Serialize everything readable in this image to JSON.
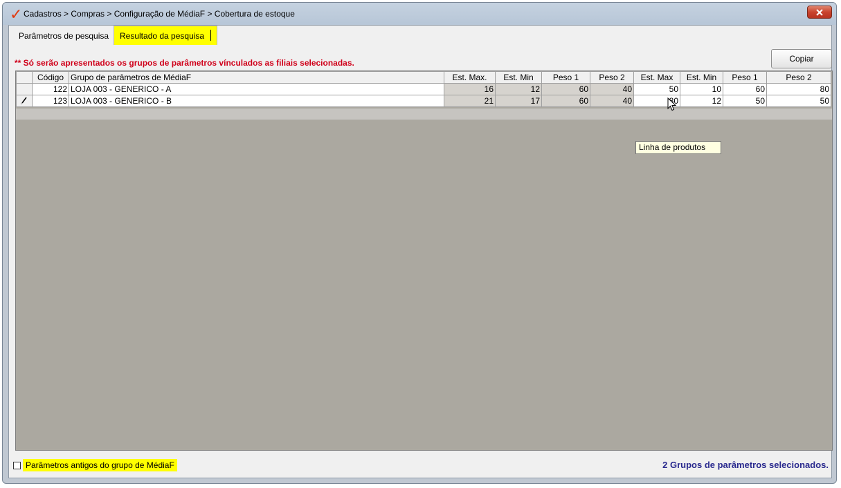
{
  "window": {
    "title": "Cadastros > Compras > Configuração de MédiaF > Cobertura de estoque",
    "app_icon": "checkmark-icon",
    "close_icon": "close-icon"
  },
  "tabs": [
    {
      "label": "Parâmetros de pesquisa",
      "active": false
    },
    {
      "label": "Resultado da pesquisa",
      "active": true
    }
  ],
  "notice": "** Só serão apresentados os grupos de parâmetros vínculados as filiais selecionadas.",
  "copy_button": "Copiar",
  "grid": {
    "columns": [
      "",
      "Código",
      "Grupo de parâmetros de MédiaF",
      "Est. Max.",
      "Est. Min",
      "Peso 1",
      "Peso 2",
      "Est. Max",
      "Est. Min",
      "Peso 1",
      "Peso 2"
    ],
    "rows": [
      {
        "indicator": "",
        "codigo": "122",
        "grupo": "LOJA 003 - GENERICO - A",
        "est_max_1": "16",
        "est_min_1": "12",
        "peso1_1": "60",
        "peso2_1": "40",
        "est_max_2": "50",
        "est_min_2": "10",
        "peso1_2": "60",
        "peso2_2": "80"
      },
      {
        "indicator": "edit-pencil-icon",
        "codigo": "123",
        "grupo": "LOJA 003 - GENERICO - B",
        "est_max_2_note": "",
        "est_max_1": "21",
        "est_min_1": "17",
        "peso1_1": "60",
        "peso2_1": "40",
        "est_max_2": "80",
        "est_min_2": "12",
        "peso1_2": "50",
        "peso2_2": "50"
      }
    ]
  },
  "tooltip": "Linha de produtos",
  "footer": {
    "checkbox_label": "Parâmetros antigos do grupo de MédiaF",
    "checkbox_checked": false,
    "status": "2 Grupos de parâmetros selecionados."
  },
  "colors": {
    "highlight": "#ffff00",
    "notice": "#d0001a",
    "status": "#2a2a8e",
    "grid_background": "#aba8a0"
  }
}
